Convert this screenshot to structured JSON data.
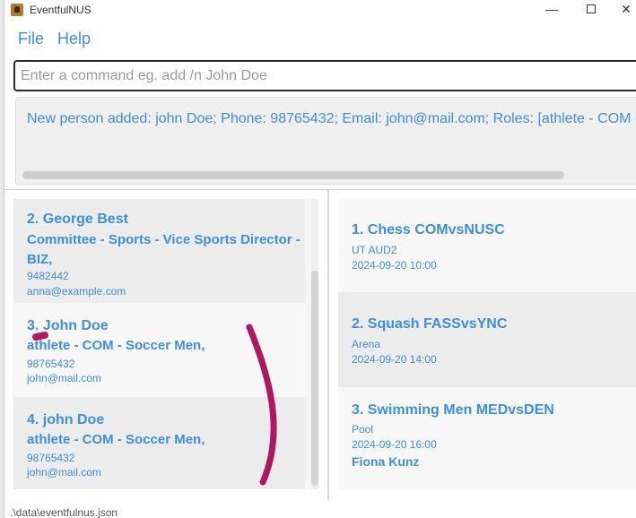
{
  "window": {
    "title": "EventfulNUS",
    "minimize": "—",
    "close": "✕"
  },
  "menu": {
    "file": "File",
    "help": "Help"
  },
  "command": {
    "placeholder": "Enter a command eg. add /n John Doe"
  },
  "result": {
    "text": "New person added: john Doe; Phone: 98765432; Email: john@mail.com; Roles: [athlete - COM - Soccer Men]"
  },
  "persons": [
    {
      "name": "2. George Best",
      "role_line1": "Committee - Sports - Vice Sports Director -",
      "role_line2": "BIZ,",
      "phone": "9482442",
      "email": "anna@example.com"
    },
    {
      "name": "3. John Doe",
      "role_line1": "athlete - COM - Soccer Men,",
      "phone": "98765432",
      "email": "john@mail.com"
    },
    {
      "name": "4. john Doe",
      "role_line1": "athlete - COM - Soccer Men,",
      "phone": "98765432",
      "email": "john@mail.com"
    }
  ],
  "events": [
    {
      "name": "1. Chess COMvsNUSC",
      "venue": "UT AUD2",
      "time": "2024-09-20 10:00"
    },
    {
      "name": "2. Squash FASSvsYNC",
      "venue": "Arena",
      "time": "2024-09-20 14:00"
    },
    {
      "name": "3. Swimming Men MEDvsDEN",
      "venue": "Pool",
      "time": "2024-09-20 16:00",
      "participant": "Fiona Kunz"
    }
  ],
  "status": {
    "path": ".\\data\\eventfulnus.json"
  },
  "colors": {
    "accent": "#3d8fe0",
    "annotation": "#b0175f"
  }
}
